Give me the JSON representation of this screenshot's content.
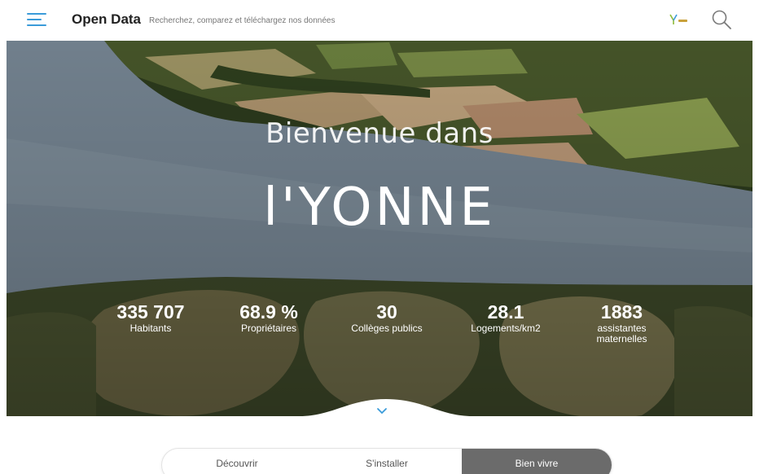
{
  "header": {
    "brand": "Open Data",
    "tagline": "Recherchez, comparez et téléchargez nos données",
    "accent_color": "#3a9bd9",
    "icons": [
      "menu-icon",
      "yonne-logo",
      "search-icon"
    ]
  },
  "hero": {
    "welcome": "Bienvenue dans",
    "place": "l'YONNE",
    "stats": [
      {
        "value": "335 707",
        "label": "Habitants"
      },
      {
        "value": "68.9 %",
        "label": "Propriétaires"
      },
      {
        "value": "30",
        "label": "Collèges publics"
      },
      {
        "value": "28.1",
        "label": "Logements/km2"
      },
      {
        "value": "1883",
        "label": "assistantes maternelles"
      }
    ],
    "scroll_icon": "chevron-down-icon"
  },
  "tabs": [
    {
      "label": "Découvrir",
      "active": false
    },
    {
      "label": "S'installer",
      "active": false
    },
    {
      "label": "Bien vivre",
      "active": true
    }
  ]
}
